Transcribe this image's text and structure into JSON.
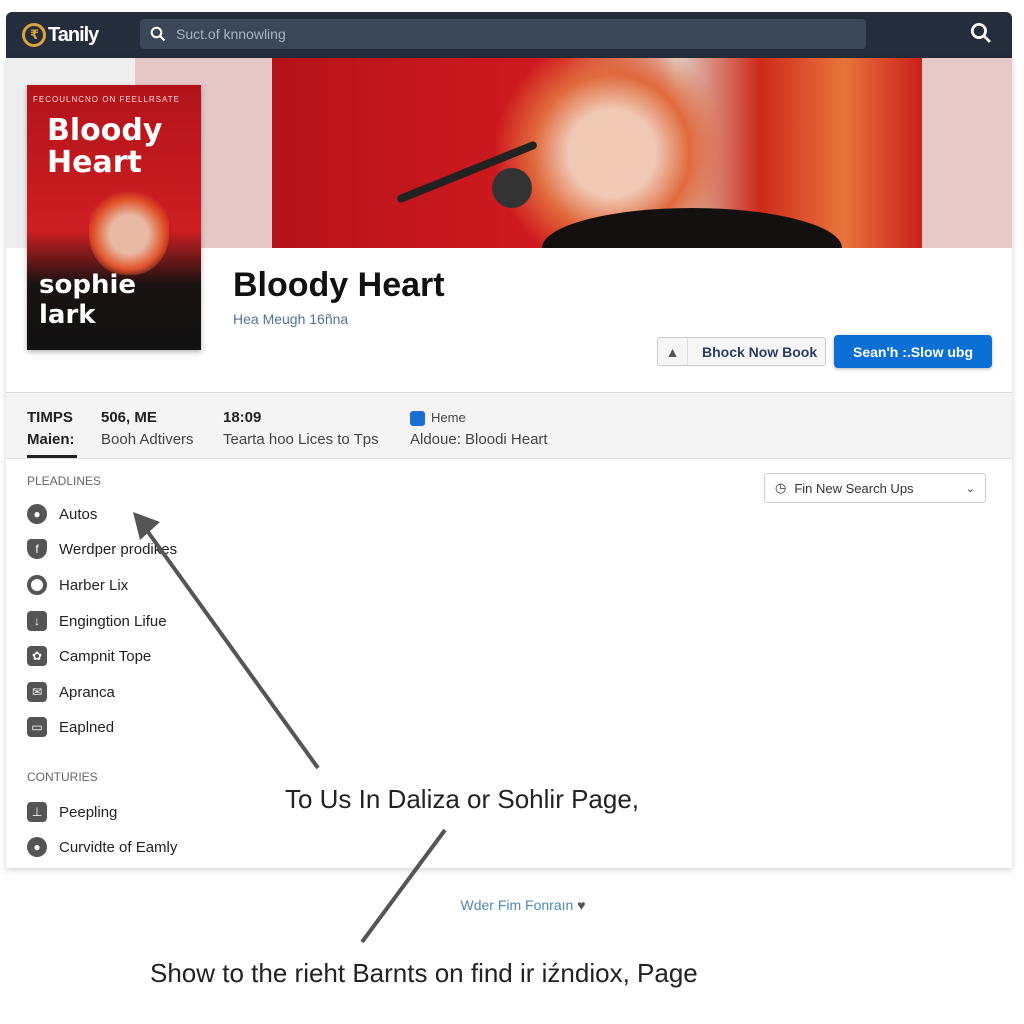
{
  "header": {
    "logo_text": "Tanily",
    "search_placeholder": "Suct.of knnowling",
    "search_icon": "search-icon"
  },
  "book": {
    "cover_tagline": "FECOULNCNO ON FEELLRSATE",
    "cover_title": "Bloody Heart",
    "cover_author": "sophie lark",
    "title": "Bloody Heart",
    "subtitle": "Hea Meugh 16ñna"
  },
  "actions": {
    "secondary": "Bhock Now Book",
    "primary": "Sean'h :.Slow ubg"
  },
  "info": [
    {
      "head": "TIMPS",
      "value": "Maien:"
    },
    {
      "head": "506, ME",
      "value": "Booh Adtivers"
    },
    {
      "head": "18:09",
      "value": "Tearta hoo Lices to Tps"
    },
    {
      "head": "Heme",
      "value": "Aldoue: Bloodi Heart"
    }
  ],
  "sidebar": {
    "section1": "PLEADLINES",
    "items1": [
      {
        "label": "Autos"
      },
      {
        "label": "Werdper prodikes"
      },
      {
        "label": "Harber Lix"
      },
      {
        "label": "Engingtion Lifue"
      },
      {
        "label": "Campnit Tope"
      },
      {
        "label": "Apranca"
      },
      {
        "label": "Eaplned"
      }
    ],
    "section2": "CONTURIES",
    "items2": [
      {
        "label": "Peepling"
      },
      {
        "label": "Curvidte of Eamly"
      }
    ]
  },
  "dropdown": {
    "selected": "Fin New Search Ups"
  },
  "annotation": {
    "overlay_text": "To Us In Daliza or Sohlir Page,",
    "caption": "Show to the rieht Barnts on find ir iźndiox, Page"
  },
  "footer": {
    "link": "Wder Fim Fonraın"
  },
  "colors": {
    "header": "#232d3b",
    "primary": "#0b6fd6",
    "hero": "#c8151c"
  }
}
